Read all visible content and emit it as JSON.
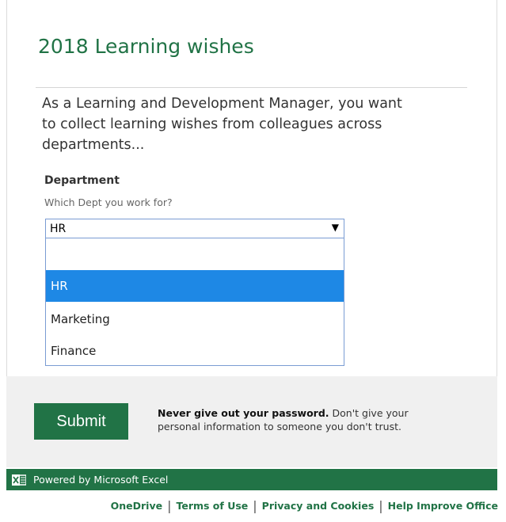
{
  "form": {
    "title": "2018 Learning wishes",
    "description_line1": "As a Learning and Development Manager, you want",
    "description_line2": "to collect learning wishes from colleagues across departments...",
    "question": {
      "title": "Department",
      "subtitle": "Which Dept you work for?",
      "selected_value": "HR",
      "options": [
        "",
        "HR",
        "Marketing",
        "Finance"
      ],
      "highlighted_index": 1
    },
    "submit_label": "Submit",
    "warning_bold": "Never give out your password.",
    "warning_text": " Don't give your personal information to someone you don't trust."
  },
  "powered_by": "Powered by Microsoft Excel",
  "footer_links": [
    "OneDrive",
    "Terms of Use",
    "Privacy and Cookies",
    "Help Improve Office"
  ],
  "colors": {
    "brand_green": "#217346",
    "highlight_blue": "#1e88e5",
    "footer_gray": "#f0f0f0"
  },
  "icons": {
    "dropdown": "triangle-down-icon",
    "excel": "excel-logo-icon"
  }
}
